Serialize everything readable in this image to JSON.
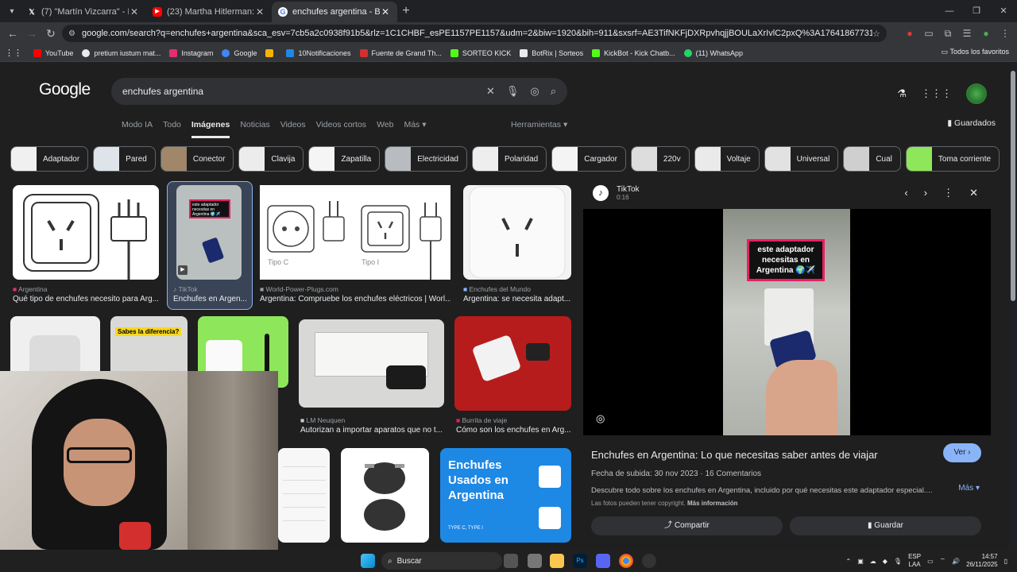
{
  "browser": {
    "tabs": [
      {
        "label": "(7) \"Martín Vizcarra\" - Buscar /",
        "icon": "x-icon",
        "active": false
      },
      {
        "label": "(23) Martha Hitlerman: animale",
        "icon": "youtube-icon",
        "active": false
      },
      {
        "label": "enchufes argentina - Buscar con",
        "icon": "google-icon",
        "active": true
      }
    ],
    "url": "google.com/search?q=enchufes+argentina&sca_esv=7cb5a2c0938f91b5&rlz=1C1CHBF_esPE1157PE1157&udm=2&biw=1920&bih=911&sxsrf=AE3TifNKFjDXRpvhqjjBOULaXrIvlC2pxQ%3A1764186773172&ei=lVonacSfCt_W5OUPtqTSkA...",
    "bookmarks": [
      {
        "label": "YouTube",
        "color": "#ff0000"
      },
      {
        "label": "pretium iustum mat...",
        "color": "#e8eaed"
      },
      {
        "label": "Instagram",
        "color": "#e1306c"
      },
      {
        "label": "Google",
        "color": "#4285f4"
      },
      {
        "label": "",
        "color": "#f4b400"
      },
      {
        "label": "10Notificaciones",
        "color": "#1e88e5"
      },
      {
        "label": "Fuente de Grand Th...",
        "color": "#d32f2f"
      },
      {
        "label": "SORTEO KICK",
        "color": "#53fc18"
      },
      {
        "label": "BotRix | Sorteos",
        "color": "#e8eaed"
      },
      {
        "label": "KickBot - Kick Chatb...",
        "color": "#53fc18"
      },
      {
        "label": "(11) WhatsApp",
        "color": "#25d366"
      }
    ],
    "bookmarks_right": "Todos los favoritos"
  },
  "google": {
    "logo": "Google",
    "query": "enchufes argentina",
    "nav": [
      "Modo IA",
      "Todo",
      "Imágenes",
      "Noticias",
      "Videos",
      "Videos cortos",
      "Web",
      "Más ▾"
    ],
    "nav_active": "Imágenes",
    "tools": "Herramientas ▾",
    "saved": "Guardados",
    "chips": [
      "Adaptador",
      "Pared",
      "Conector",
      "Clavija",
      "Zapatilla",
      "Electricidad",
      "Polaridad",
      "Cargador",
      "220v",
      "Voltaje",
      "Universal",
      "Cual",
      "Toma corriente"
    ]
  },
  "results": [
    {
      "source": "Argentina",
      "title": "Qué tipo de enchufes necesito para Arg..."
    },
    {
      "source": "TikTok",
      "title": "Enchufes en Argen..."
    },
    {
      "source": "World-Power-Plugs.com",
      "title": "Argentina: Compruebe los enchufes eléctricos | Worl..."
    },
    {
      "source": "Enchufes del Mundo",
      "title": "Argentina: se necesita adapt..."
    },
    {
      "source": "LM Neuquen",
      "title": "Autorizan a importar aparatos que no t..."
    },
    {
      "source": "Burrita de viaje",
      "title": "Cómo son los enchufes en Arg..."
    }
  ],
  "image_text": {
    "tipo_c": "Tipo C",
    "tipo_i": "Tipo I",
    "sabes": "Sabes la diferencia?",
    "poster_line1": "Enchufes",
    "poster_line2": "Usados en",
    "poster_line3": "Argentina",
    "poster_sub": "TYPE C, TYPE I",
    "video_overlay": "este adaptador necesitas en Argentina 🌍✈️"
  },
  "panel": {
    "source": "TikTok",
    "duration": "0:16",
    "title": "Enchufes en Argentina: Lo que necesitas saber antes de viajar",
    "view_btn": "Ver ›",
    "date": "Fecha de subida: 30 nov 2023",
    "comments": "16 Comentarios",
    "description": "Descubre todo sobre los enchufes en Argentina, incluido por qué necesitas este adaptador especial....",
    "more": "Más ▾",
    "copyright": "Las fotos pueden tener copyright.",
    "copyright_link": "Más información",
    "share": "Compartir",
    "save": "Guardar"
  },
  "taskbar": {
    "search": "Buscar",
    "lang1": "ESP",
    "lang2": "LAA",
    "time": "14:57",
    "date": "26/11/2025"
  }
}
